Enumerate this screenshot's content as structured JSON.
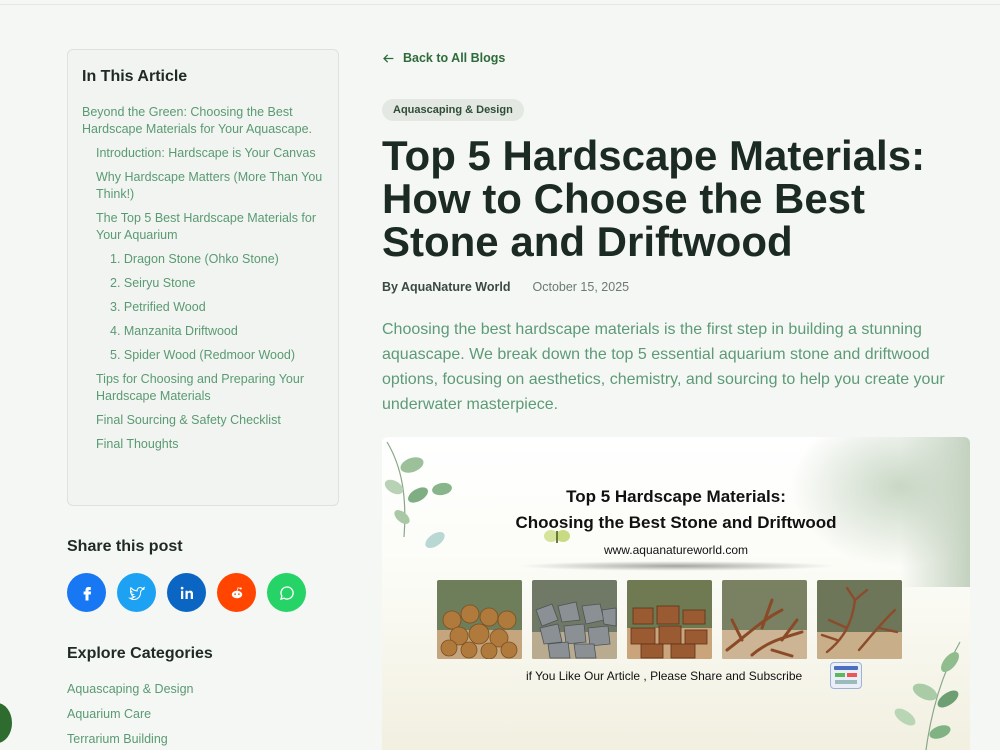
{
  "toc": {
    "title": "In This Article",
    "items": [
      {
        "label": "Beyond the Green: Choosing the Best Hardscape Materials for Your Aquascape.",
        "level": 1
      },
      {
        "label": "Introduction: Hardscape is Your Canvas",
        "level": 2
      },
      {
        "label": "Why Hardscape Matters (More Than You Think!)",
        "level": 2
      },
      {
        "label": "The Top 5 Best Hardscape Materials for Your Aquarium",
        "level": 2
      },
      {
        "label": "1. Dragon Stone (Ohko Stone)",
        "level": 3
      },
      {
        "label": "2. Seiryu Stone",
        "level": 3
      },
      {
        "label": "3. Petrified Wood",
        "level": 3
      },
      {
        "label": "4. Manzanita Driftwood",
        "level": 3
      },
      {
        "label": "5. Spider Wood (Redmoor Wood)",
        "level": 3
      },
      {
        "label": "Tips for Choosing and Preparing Your Hardscape Materials",
        "level": 2
      },
      {
        "label": "Final Sourcing & Safety Checklist",
        "level": 2
      },
      {
        "label": "Final Thoughts",
        "level": 2
      }
    ]
  },
  "share": {
    "title": "Share this post",
    "buttons": [
      {
        "name": "facebook",
        "color": "#1877f2"
      },
      {
        "name": "twitter",
        "color": "#1da1f2"
      },
      {
        "name": "linkedin",
        "color": "#0a66c2"
      },
      {
        "name": "reddit",
        "color": "#ff4500"
      },
      {
        "name": "whatsapp",
        "color": "#25d366"
      }
    ]
  },
  "categories": {
    "title": "Explore Categories",
    "items": [
      "Aquascaping & Design",
      "Aquarium Care",
      "Terrarium Building"
    ]
  },
  "article": {
    "back_label": "Back to All Blogs",
    "category_badge": "Aquascaping & Design",
    "title": "Top 5 Hardscape Materials: How to Choose the Best Stone and Driftwood",
    "author": "By AquaNature World",
    "date": "October 15, 2025",
    "intro": "Choosing the best hardscape materials is the first step in building a stunning aquascape. We break down the top 5 essential aquarium stone and driftwood options, focusing on aesthetics, chemistry, and sourcing to help you create your underwater masterpiece."
  },
  "hero": {
    "line1": "Top 5 Hardscape Materials:",
    "line2": "Choosing the Best Stone and Driftwood",
    "url": "www.aquanatureworld.com",
    "footer": "if You Like Our Article , Please Share and Subscribe"
  },
  "colors": {
    "accent_green": "#5a9a72",
    "dark_green": "#2f6b3a",
    "title_text": "#1b2a22"
  }
}
